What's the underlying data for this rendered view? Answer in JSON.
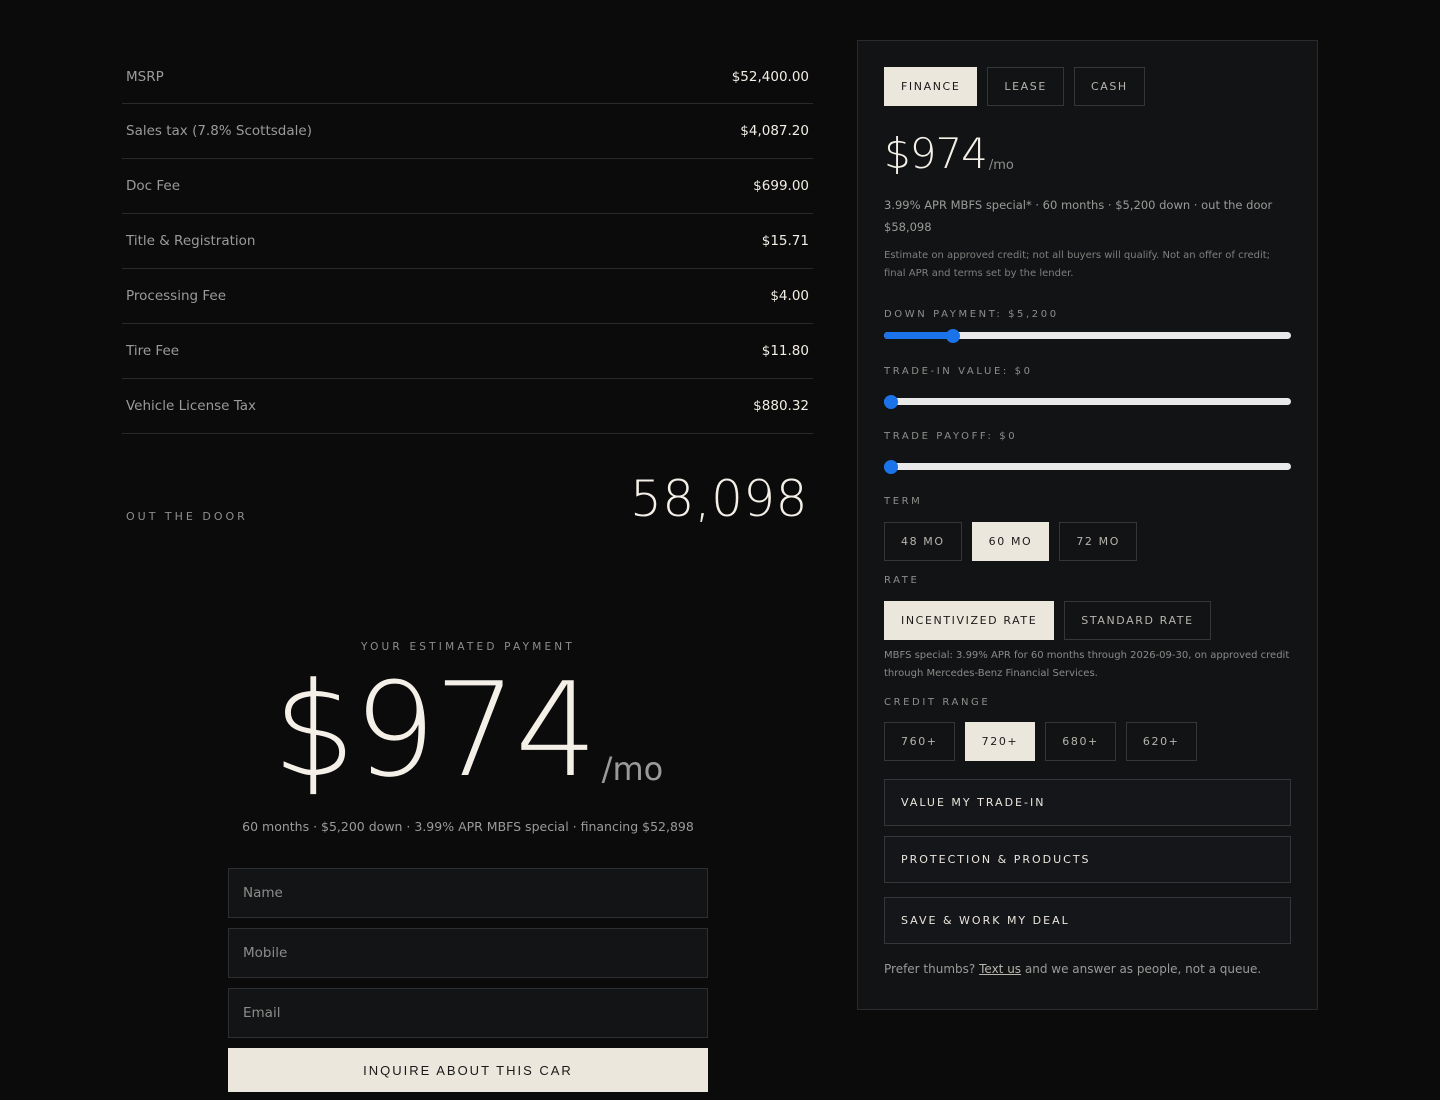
{
  "fees": [
    {
      "label": "MSRP",
      "value": "$52,400.00"
    },
    {
      "label": "Sales tax (7.8% Scottsdale)",
      "value": "$4,087.20"
    },
    {
      "label": "Doc Fee",
      "value": "$699.00"
    },
    {
      "label": "Title & Registration",
      "value": "$15.71"
    },
    {
      "label": "Processing Fee",
      "value": "$4.00"
    },
    {
      "label": "Tire Fee",
      "value": "$11.80"
    },
    {
      "label": "Vehicle License Tax",
      "value": "$880.32"
    }
  ],
  "out_the_door": {
    "label": "OUT THE DOOR",
    "value": "58,098"
  },
  "estimate": {
    "label": "YOUR ESTIMATED PAYMENT",
    "amount": "$974",
    "unit": "/mo",
    "summary": "60 months · $5,200 down · 3.99% APR MBFS special · financing $52,898"
  },
  "form": {
    "name_placeholder": "Name",
    "mobile_placeholder": "Mobile",
    "email_placeholder": "Email",
    "submit_label": "INQUIRE ABOUT THIS CAR"
  },
  "panel": {
    "tabs": [
      {
        "label": "FINANCE",
        "active": true
      },
      {
        "label": "LEASE",
        "active": false
      },
      {
        "label": "CASH",
        "active": false
      }
    ],
    "payment": {
      "amount": "$974",
      "unit": "/mo"
    },
    "terms_line": "3.99% APR MBFS special* · 60 months · $5,200 down · out the door $58,098",
    "disclaimer": "Estimate on approved credit; not all buyers will qualify. Not an offer of credit; final APR and terms set by the lender.",
    "sliders": [
      {
        "label": "DOWN PAYMENT: $5,200",
        "fraction": 0.17
      },
      {
        "label": "TRADE-IN VALUE: $0",
        "fraction": 0
      },
      {
        "label": "TRADE PAYOFF: $0",
        "fraction": 0
      }
    ],
    "term": {
      "label": "TERM",
      "options": [
        {
          "label": "48 MO",
          "active": false
        },
        {
          "label": "60 MO",
          "active": true
        },
        {
          "label": "72 MO",
          "active": false
        }
      ]
    },
    "rate": {
      "label": "RATE",
      "options": [
        {
          "label": "INCENTIVIZED RATE",
          "active": true
        },
        {
          "label": "STANDARD RATE",
          "active": false
        }
      ],
      "note": "MBFS special: 3.99% APR for 60 months through 2026-09-30, on approved credit through Mercedes-Benz Financial Services."
    },
    "credit": {
      "label": "CREDIT RANGE",
      "options": [
        {
          "label": "760+",
          "active": false
        },
        {
          "label": "720+",
          "active": true
        },
        {
          "label": "680+",
          "active": false
        },
        {
          "label": "620+",
          "active": false
        }
      ]
    },
    "actions": [
      {
        "label": "VALUE MY TRADE-IN"
      },
      {
        "label": "PROTECTION & PRODUCTS"
      },
      {
        "label": "SAVE & WORK MY DEAL"
      }
    ],
    "footer": {
      "prefix": "Prefer thumbs?",
      "link": "Text us",
      "suffix": "and we answer as people, not a queue."
    }
  },
  "colors": {
    "accent": "#1a73e8",
    "active_pill": "#ece7dc",
    "background": "#0b0b0c",
    "panel": "#121314"
  }
}
